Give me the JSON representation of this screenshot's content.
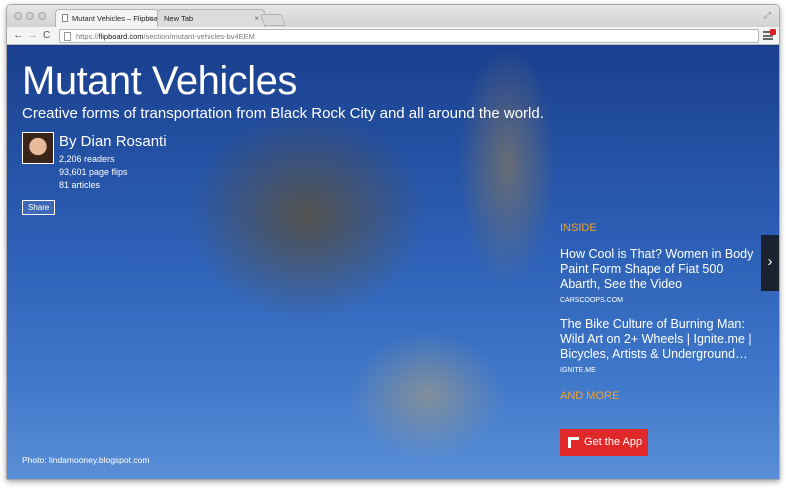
{
  "browser": {
    "tabs": [
      {
        "label": "Mutant Vehicles – Flipboar",
        "close": "×"
      },
      {
        "label": "New Tab",
        "close": "×"
      }
    ],
    "url_scheme": "https://",
    "url_host": "flipboard.com",
    "url_path": "/section/mutant-vehicles-bv4EEM",
    "back": "←",
    "forward": "→",
    "reload": "C",
    "fullscreen": "⤢"
  },
  "section": {
    "title": "Mutant Vehicles",
    "subtitle": "Creative forms of transportation from Black Rock City and all around the world.",
    "author": "By Dian Rosanti",
    "readers": "2,206 readers",
    "page_flips": "93,601 page flips",
    "articles": "81 articles",
    "share_label": "Share",
    "photo_credit": "Photo: lindamooney.blogspot.com"
  },
  "sidebar": {
    "inside_label": "INSIDE",
    "articles": [
      {
        "title": "How Cool is That? Women in Body Paint Form Shape of Fiat 500 Abarth, See the Video",
        "source": "CARSCOOPS.COM"
      },
      {
        "title": "The Bike Culture of Burning Man: Wild Art on 2+ Wheels | Ignite.me | Bicycles, Artists & Underground…",
        "source": "IGNITE.ME"
      }
    ],
    "and_more": "AND MORE",
    "get_app": "Get the App",
    "next_arrow": "›"
  },
  "colors": {
    "accent_orange": "#f0a030",
    "app_button_red": "#e12828"
  }
}
